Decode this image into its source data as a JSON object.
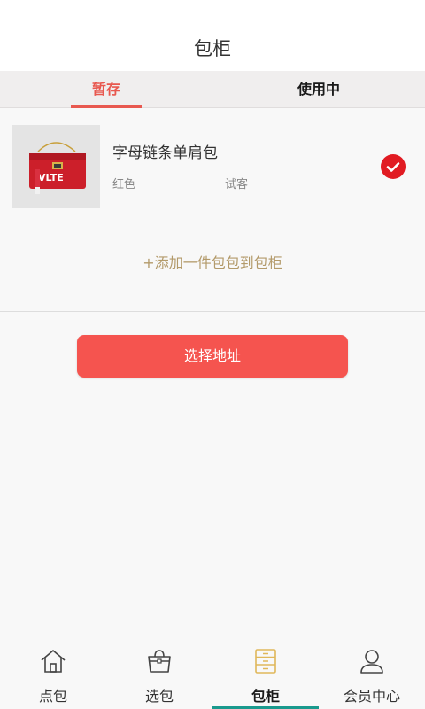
{
  "header": {
    "title": "包柜"
  },
  "tabs": [
    {
      "label": "暂存"
    },
    {
      "label": "使用中"
    }
  ],
  "item": {
    "name": "字母链条单肩包",
    "color": "红色",
    "tag": "试客",
    "checked": true,
    "thumbnail": {
      "bag_text": "VLTE"
    }
  },
  "add_link": "+添加一件包包到包柜",
  "address_button": "选择地址",
  "bottom_nav": [
    {
      "label": "点包",
      "icon": "home-icon"
    },
    {
      "label": "选包",
      "icon": "bag-icon"
    },
    {
      "label": "包柜",
      "icon": "cabinet-icon"
    },
    {
      "label": "会员中心",
      "icon": "user-icon"
    }
  ],
  "colors": {
    "accent": "#e8584f",
    "button": "#f5544f",
    "add_link": "#b39a6a",
    "nav_active_indicator": "#1a9a8e",
    "cabinet_icon": "#e0b75a"
  }
}
